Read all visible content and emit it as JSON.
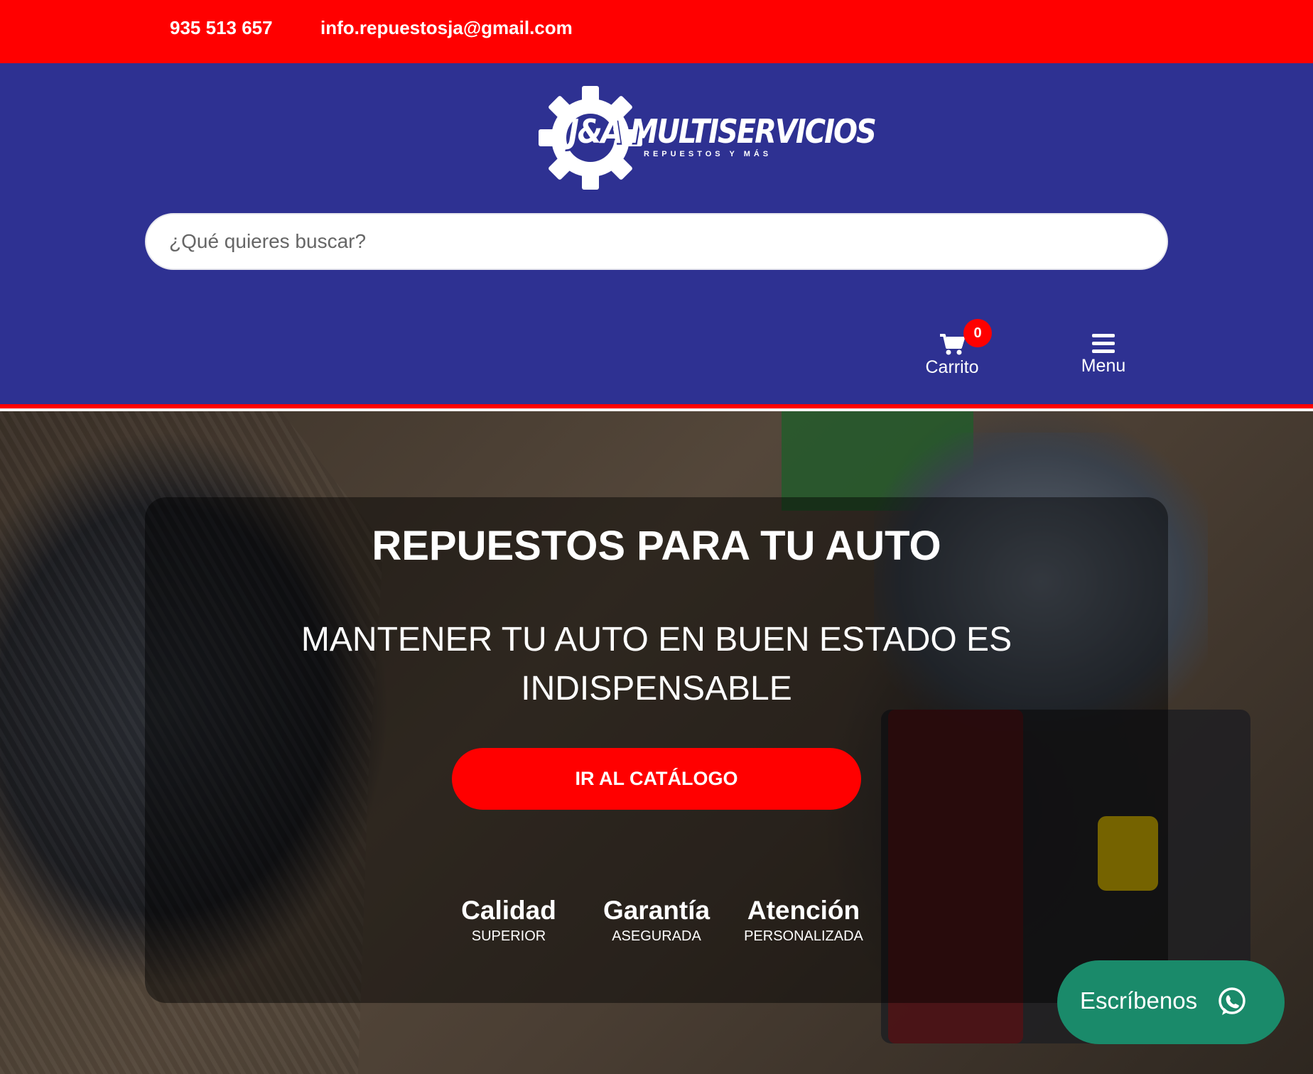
{
  "topbar": {
    "phone": "935 513 657",
    "email": "info.repuestosja@gmail.com",
    "background": "#ff0000"
  },
  "header": {
    "logo": {
      "brand": "J&A MULTISERVICIOS",
      "tagline": "REPUESTOS Y MÁS",
      "icon": "gear-icon"
    },
    "search": {
      "placeholder": "¿Qué quieres buscar?",
      "value": ""
    },
    "cart": {
      "label": "Carrito",
      "count": "0",
      "icon": "cart-icon"
    },
    "menu": {
      "label": "Menu",
      "icon": "hamburger-icon"
    },
    "background": "#2e3192"
  },
  "hero": {
    "title": "REPUESTOS PARA TU AUTO",
    "subtitle": "MANTENER TU AUTO EN BUEN ESTADO ES INDISPENSABLE",
    "cta_label": "IR AL CATÁLOGO",
    "features": [
      {
        "title": "Calidad",
        "subtitle": "SUPERIOR"
      },
      {
        "title": "Garantía",
        "subtitle": "ASEGURADA"
      },
      {
        "title": "Atención",
        "subtitle": "PERSONALIZADA"
      }
    ]
  },
  "whatsapp": {
    "label": "Escríbenos",
    "icon": "whatsapp-icon",
    "color": "#1a8a6a"
  }
}
